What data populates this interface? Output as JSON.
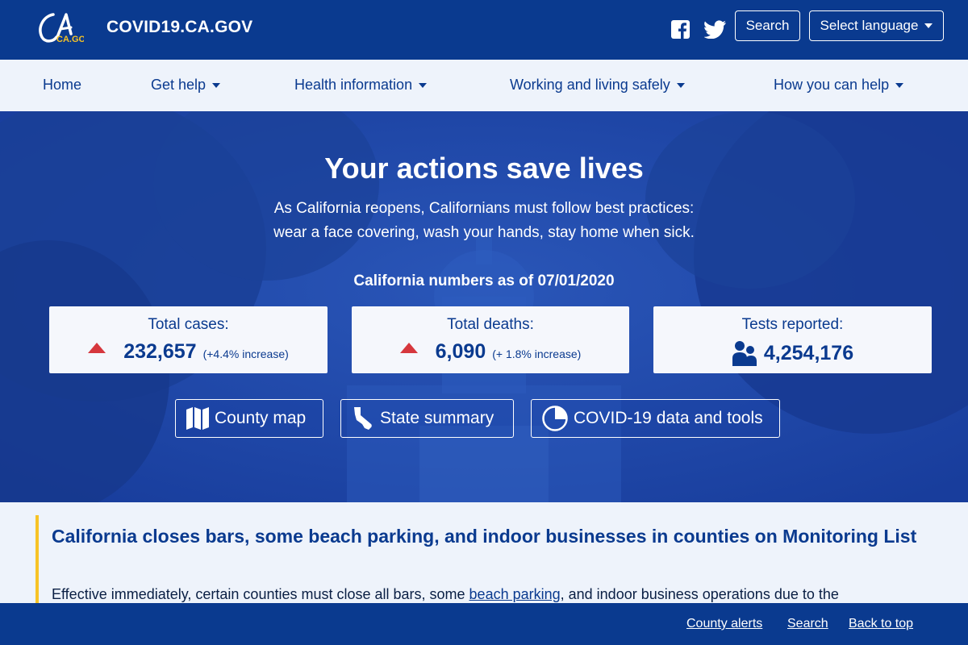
{
  "header": {
    "logo_text": "CA.GOV",
    "site_title": "COVID19.CA.GOV",
    "search_label": "Search",
    "language_label": "Select language"
  },
  "nav": {
    "items": [
      {
        "label": "Home",
        "has_dropdown": false
      },
      {
        "label": "Get help",
        "has_dropdown": true
      },
      {
        "label": "Health information",
        "has_dropdown": true
      },
      {
        "label": "Working and living safely",
        "has_dropdown": true
      },
      {
        "label": "How you can help",
        "has_dropdown": true
      }
    ]
  },
  "hero": {
    "title": "Your actions save lives",
    "subtitle_line1": "As California reopens, Californians must follow best practices:",
    "subtitle_line2": "wear a face covering, wash your hands, stay home when sick.",
    "numbers_heading": "California numbers as of 07/01/2020",
    "stats": [
      {
        "label": "Total cases:",
        "value": "232,657",
        "delta": "(+4.4% increase)",
        "icon": "up-arrow-icon"
      },
      {
        "label": "Total deaths:",
        "value": "6,090",
        "delta": "(+ 1.8% increase)",
        "icon": "up-arrow-icon"
      },
      {
        "label": "Tests reported:",
        "value": "4,254,176",
        "delta": "",
        "icon": "people-icon"
      }
    ],
    "buttons": [
      {
        "label": "County map",
        "icon": "map-icon"
      },
      {
        "label": "State summary",
        "icon": "california-icon"
      },
      {
        "label": "COVID-19 data and tools",
        "icon": "pie-chart-icon"
      }
    ]
  },
  "alert": {
    "title": "California closes bars, some beach parking, and indoor businesses in counties on Monitoring List",
    "text_before": "Effective immediately, certain counties must close all bars, some ",
    "link_text": "beach parking",
    "text_after": ", and indoor business operations due to the"
  },
  "footer": {
    "links": [
      "County alerts",
      "Search",
      "Back to top"
    ]
  },
  "colors": {
    "brand_blue": "#0a3a8f",
    "hero_blue": "#1d44a8",
    "alert_yellow": "#f7c325",
    "increase_red": "#d6373d"
  }
}
